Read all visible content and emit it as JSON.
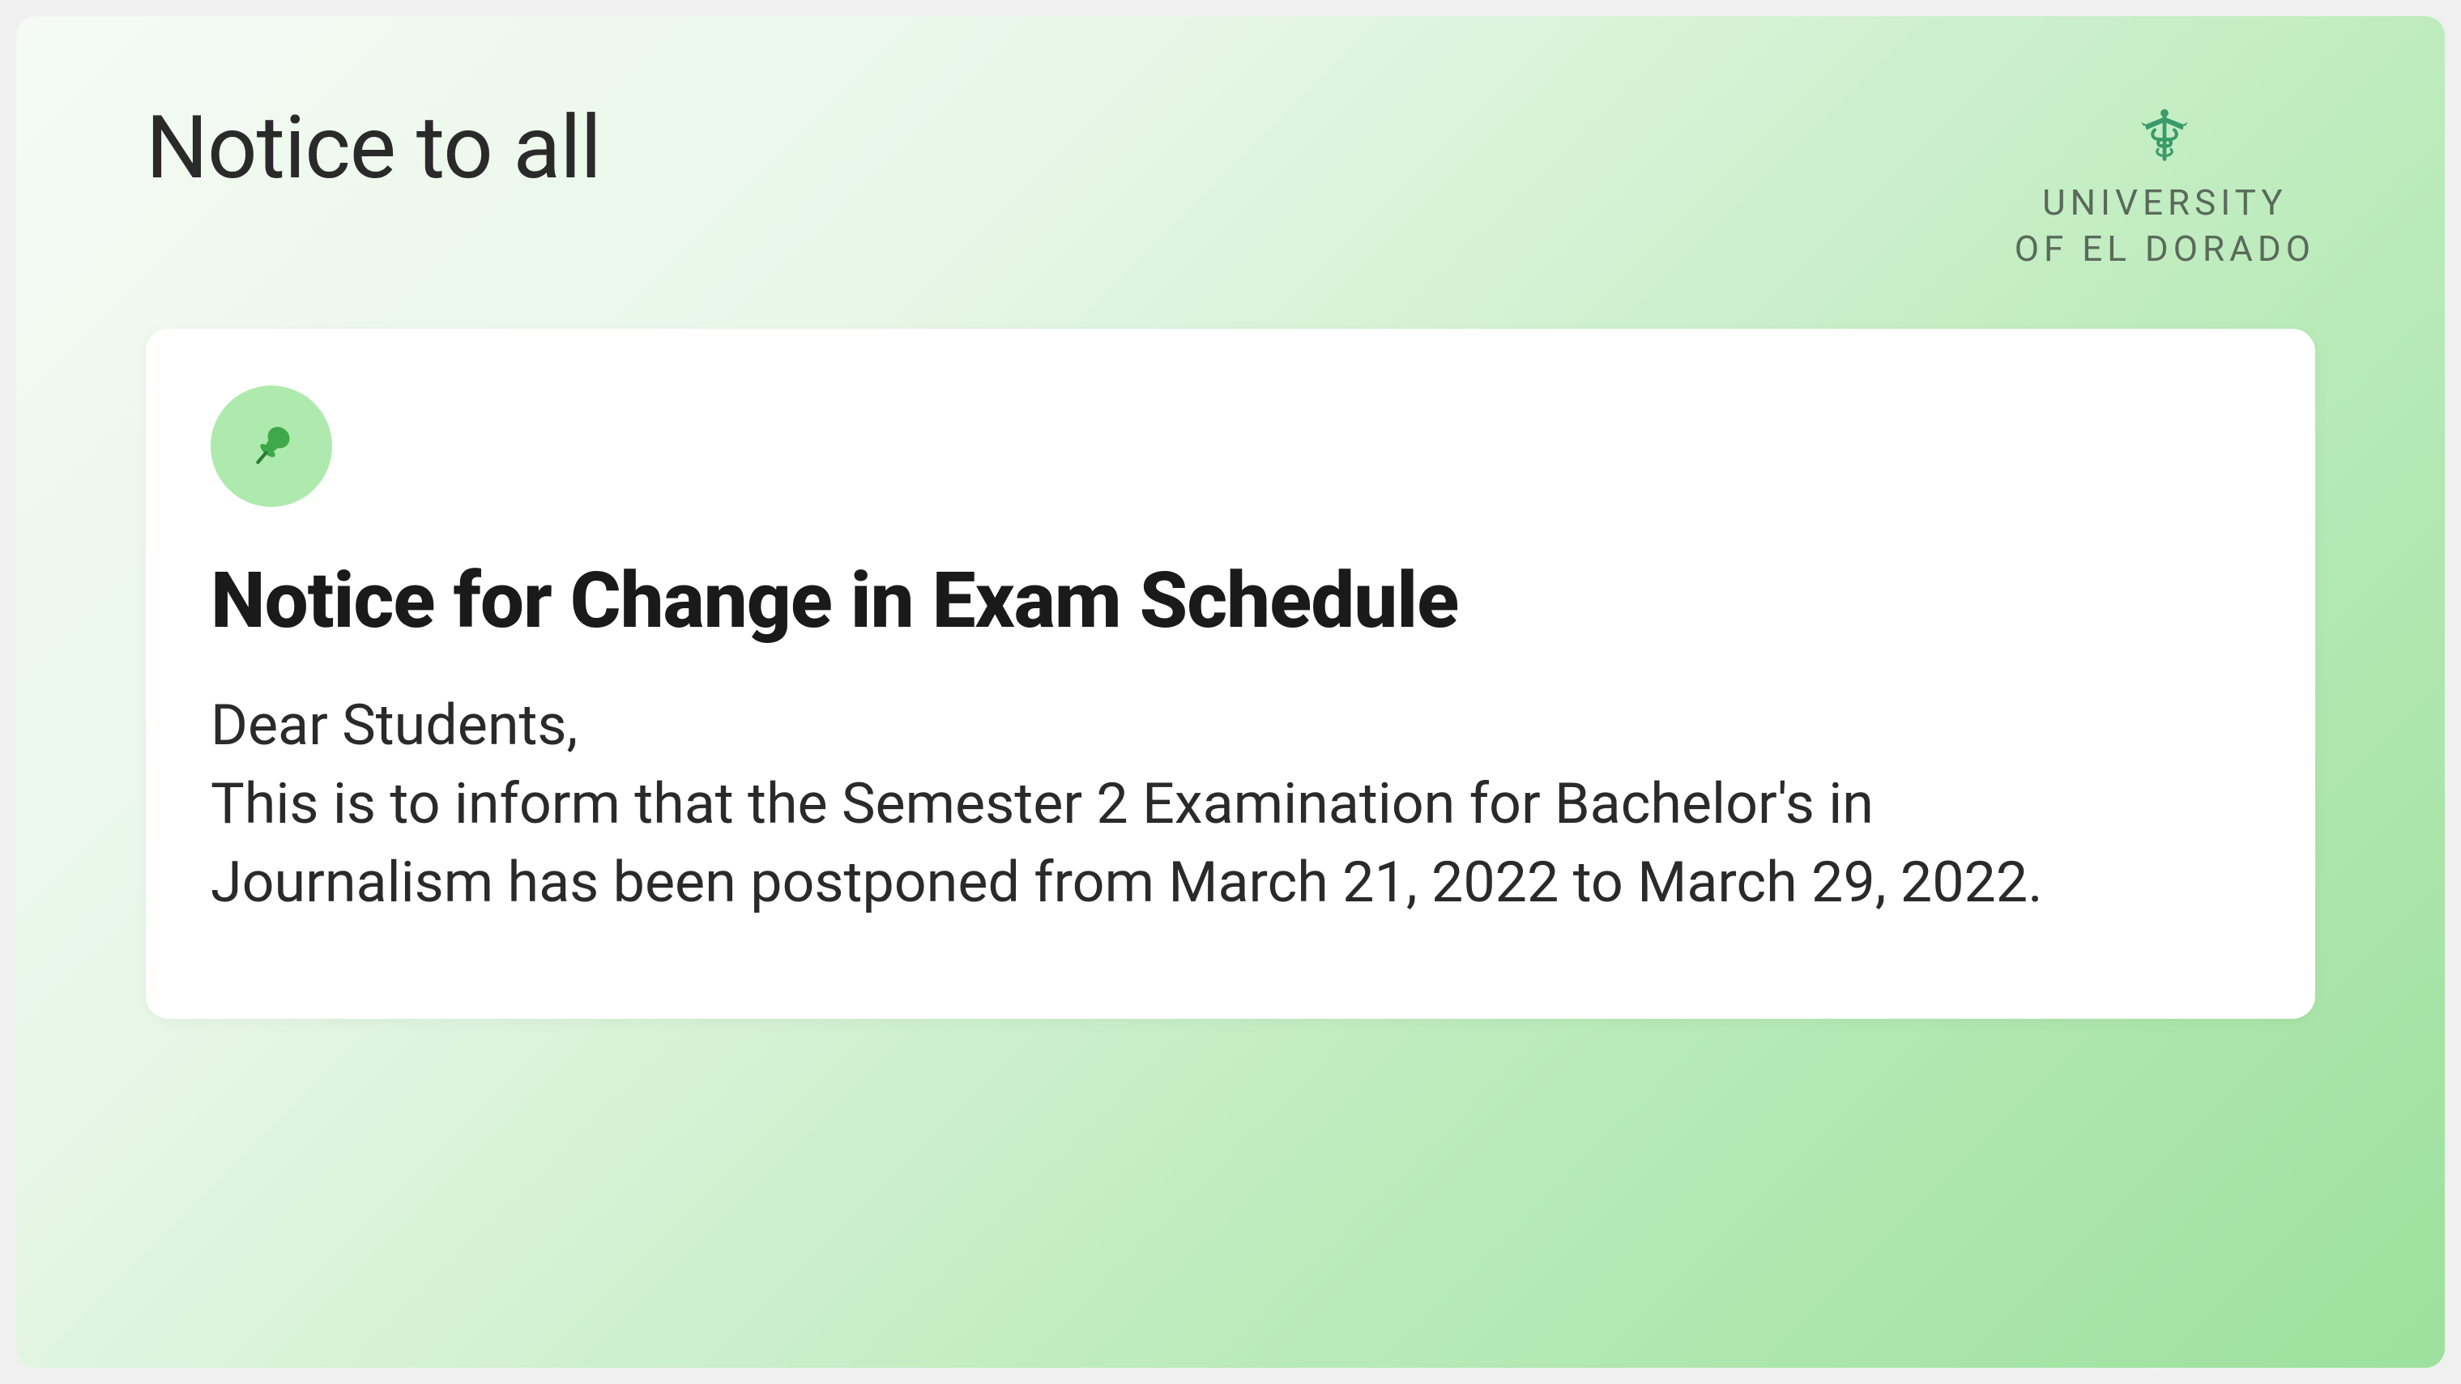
{
  "header": {
    "title": "Notice to all",
    "university": {
      "line1": "UNIVERSITY",
      "line2": "OF EL DORADO"
    }
  },
  "notice": {
    "title": "Notice for Change in Exam Schedule",
    "salutation": "Dear Students,",
    "body": "This is to inform that the Semester 2 Examination for Bachelor's in Journalism has been postponed from March 21, 2022 to March 29, 2022."
  },
  "icons": {
    "pin": "pin-icon",
    "caduceus": "caduceus-icon"
  },
  "colors": {
    "pin_bg": "#aeeaae",
    "pin_fg": "#3fa84a",
    "logo_fg": "#3a9a6a",
    "text_dark": "#1a1a1a"
  }
}
